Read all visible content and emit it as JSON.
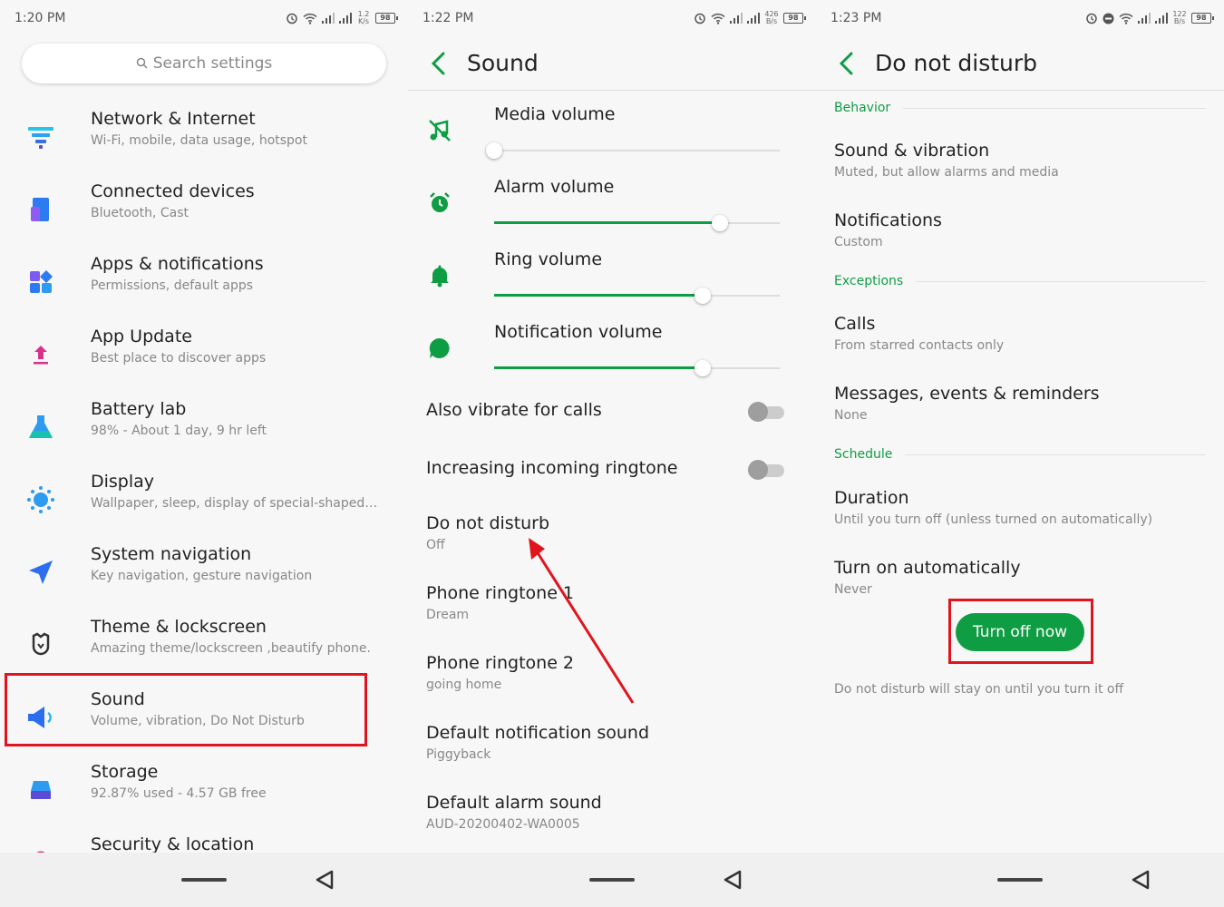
{
  "colors": {
    "accent": "#0f9d44",
    "highlight": "#e0141e",
    "background": "#f7f7f7"
  },
  "panel1": {
    "status": {
      "time": "1:20 PM",
      "net_speed_value": "1.2",
      "net_speed_unit": "K/s",
      "battery": "98"
    },
    "search": {
      "placeholder": "Search settings",
      "icon": "search-icon"
    },
    "items": [
      {
        "title": "Network & Internet",
        "subtitle": "Wi-Fi, mobile, data usage, hotspot",
        "icon": "wifi-icon"
      },
      {
        "title": "Connected devices",
        "subtitle": "Bluetooth, Cast",
        "icon": "devices-icon"
      },
      {
        "title": "Apps & notifications",
        "subtitle": "Permissions, default apps",
        "icon": "apps-icon"
      },
      {
        "title": "App Update",
        "subtitle": "Best place to discover apps",
        "icon": "upload-icon"
      },
      {
        "title": "Battery lab",
        "subtitle": "98% - About 1 day, 9 hr left",
        "icon": "flask-icon"
      },
      {
        "title": "Display",
        "subtitle": "Wallpaper, sleep, display of special-shaped s...",
        "icon": "sun-icon"
      },
      {
        "title": "System navigation",
        "subtitle": "Key navigation, gesture navigation",
        "icon": "navigation-arrow-icon"
      },
      {
        "title": "Theme & lockscreen",
        "subtitle": "Amazing theme/lockscreen ,beautify phone.",
        "icon": "theme-icon"
      },
      {
        "title": "Sound",
        "subtitle": "Volume, vibration, Do Not Disturb",
        "icon": "speaker-icon"
      },
      {
        "title": "Storage",
        "subtitle": "92.87% used - 4.57 GB free",
        "icon": "storage-icon"
      },
      {
        "title": "Security & location",
        "subtitle": "",
        "icon": "lock-icon"
      }
    ]
  },
  "panel2": {
    "status": {
      "time": "1:22 PM",
      "net_speed_value": "426",
      "net_speed_unit": "B/s",
      "battery": "98"
    },
    "title": "Sound",
    "volumes": [
      {
        "label": "Media volume",
        "level": 0.0,
        "icon": "music-off-icon"
      },
      {
        "label": "Alarm volume",
        "level": 0.79,
        "icon": "alarm-icon"
      },
      {
        "label": "Ring volume",
        "level": 0.73,
        "icon": "bell-icon"
      },
      {
        "label": "Notification volume",
        "level": 0.73,
        "icon": "chat-bubble-icon"
      }
    ],
    "toggles": [
      {
        "label": "Also vibrate for calls",
        "on": false
      },
      {
        "label": "Increasing incoming ringtone",
        "on": false
      }
    ],
    "prefs": [
      {
        "title": "Do not disturb",
        "subtitle": "Off"
      },
      {
        "title": "Phone ringtone 1",
        "subtitle": "Dream"
      },
      {
        "title": "Phone ringtone 2",
        "subtitle": "going home"
      },
      {
        "title": "Default notification sound",
        "subtitle": "Piggyback"
      },
      {
        "title": "Default alarm sound",
        "subtitle": "AUD-20200402-WA0005"
      }
    ]
  },
  "panel3": {
    "status": {
      "time": "1:23 PM",
      "net_speed_value": "122",
      "net_speed_unit": "B/s",
      "battery": "98"
    },
    "title": "Do not disturb",
    "sections": {
      "behavior": "Behavior",
      "exceptions": "Exceptions",
      "schedule": "Schedule"
    },
    "prefs": {
      "sound_vibration": {
        "title": "Sound & vibration",
        "subtitle": "Muted, but allow alarms and media"
      },
      "notifications": {
        "title": "Notifications",
        "subtitle": "Custom"
      },
      "calls": {
        "title": "Calls",
        "subtitle": "From starred contacts only"
      },
      "messages": {
        "title": "Messages, events & reminders",
        "subtitle": "None"
      },
      "duration": {
        "title": "Duration",
        "subtitle": "Until you turn off (unless turned on automatically)"
      },
      "auto": {
        "title": "Turn on automatically",
        "subtitle": "Never"
      }
    },
    "button_label": "Turn off now",
    "footer": "Do not disturb will stay on until you turn it off"
  }
}
